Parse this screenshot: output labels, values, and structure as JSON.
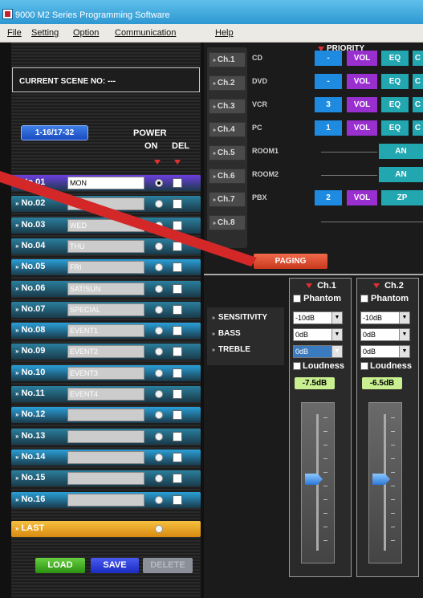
{
  "window": {
    "title": "9000 M2 Series Programming Software"
  },
  "menu": {
    "items": [
      "File",
      "Setting",
      "Option",
      "Communication",
      "Help"
    ]
  },
  "scene": {
    "current_label": "CURRENT SCENE NO: ---",
    "range_button": "1-16/17-32",
    "power_header_1": "POWER",
    "power_header_2": "ON",
    "del_header": "DEL",
    "rows": [
      {
        "label": "No.01",
        "name": "MON",
        "color": "#6e3ee0"
      },
      {
        "label": "No.02",
        "name": "",
        "color": "#2a7f9e"
      },
      {
        "label": "No.03",
        "name": "WED",
        "color": "#2a7f9e"
      },
      {
        "label": "No.04",
        "name": "THU",
        "color": "#2a7f9e"
      },
      {
        "label": "No.05",
        "name": "FRI",
        "color": "#2aa0d8"
      },
      {
        "label": "No.06",
        "name": "SAT/SUN",
        "color": "#2a7f9e"
      },
      {
        "label": "No.07",
        "name": "SPECIAL",
        "color": "#2a7f9e"
      },
      {
        "label": "No.08",
        "name": "EVENT1",
        "color": "#2aa0d8"
      },
      {
        "label": "No.09",
        "name": "EVENT2",
        "color": "#2a7f9e"
      },
      {
        "label": "No.10",
        "name": "EVENT3",
        "color": "#2aa0d8"
      },
      {
        "label": "No.11",
        "name": "EVENT4",
        "color": "#2a7f9e"
      },
      {
        "label": "No.12",
        "name": "",
        "color": "#2aa0d8"
      },
      {
        "label": "No.13",
        "name": "",
        "color": "#2a7f9e"
      },
      {
        "label": "No.14",
        "name": "",
        "color": "#2aa0d8"
      },
      {
        "label": "No.15",
        "name": "",
        "color": "#2a7f9e"
      },
      {
        "label": "No.16",
        "name": "",
        "color": "#2aa0d8"
      }
    ],
    "last_label": "LAST",
    "load_label": "LOAD",
    "save_label": "SAVE",
    "delete_label": "DELETE"
  },
  "priority": {
    "header": "PRIORITY",
    "channels": [
      {
        "ch": "Ch.1",
        "source": "CD",
        "prio": "-",
        "boxes": [
          "VOL",
          "EQ",
          "C"
        ]
      },
      {
        "ch": "Ch.2",
        "source": "DVD",
        "prio": "-",
        "boxes": [
          "VOL",
          "EQ",
          "C"
        ]
      },
      {
        "ch": "Ch.3",
        "source": "VCR",
        "prio": "3",
        "boxes": [
          "VOL",
          "EQ",
          "C"
        ]
      },
      {
        "ch": "Ch.4",
        "source": "PC",
        "prio": "1",
        "boxes": [
          "VOL",
          "EQ",
          "C"
        ]
      },
      {
        "ch": "Ch.5",
        "source": "ROOM1",
        "prio": "",
        "boxes": [
          "AN"
        ]
      },
      {
        "ch": "Ch.6",
        "source": "ROOM2",
        "prio": "",
        "boxes": [
          "AN"
        ]
      },
      {
        "ch": "Ch.7",
        "source": "PBX",
        "prio": "2",
        "boxes": [
          "VOL",
          "ZP"
        ]
      },
      {
        "ch": "Ch.8",
        "source": "",
        "prio": "",
        "boxes": []
      }
    ],
    "paging_label": "PAGING"
  },
  "tone": {
    "labels": [
      "SENSITIVITY",
      "BASS",
      "TREBLE"
    ],
    "phantom_label": "Phantom",
    "loudness_label": "Loudness",
    "strips": [
      {
        "title": "Ch.1",
        "sensitivity": "-10dB",
        "bass": "0dB",
        "treble": "0dB",
        "level": "-7.5dB"
      },
      {
        "title": "Ch.2",
        "sensitivity": "-10dB",
        "bass": "0dB",
        "treble": "0dB",
        "level": "-6.5dB"
      }
    ]
  },
  "colors": {
    "vol_box": "#9a2fd0",
    "eq_box": "#22a6b0",
    "prio_box": "#1e8ae0",
    "paging": "#e0502e",
    "load": "#3cb020",
    "save": "#2040e0",
    "last_row": "#e8a420"
  }
}
